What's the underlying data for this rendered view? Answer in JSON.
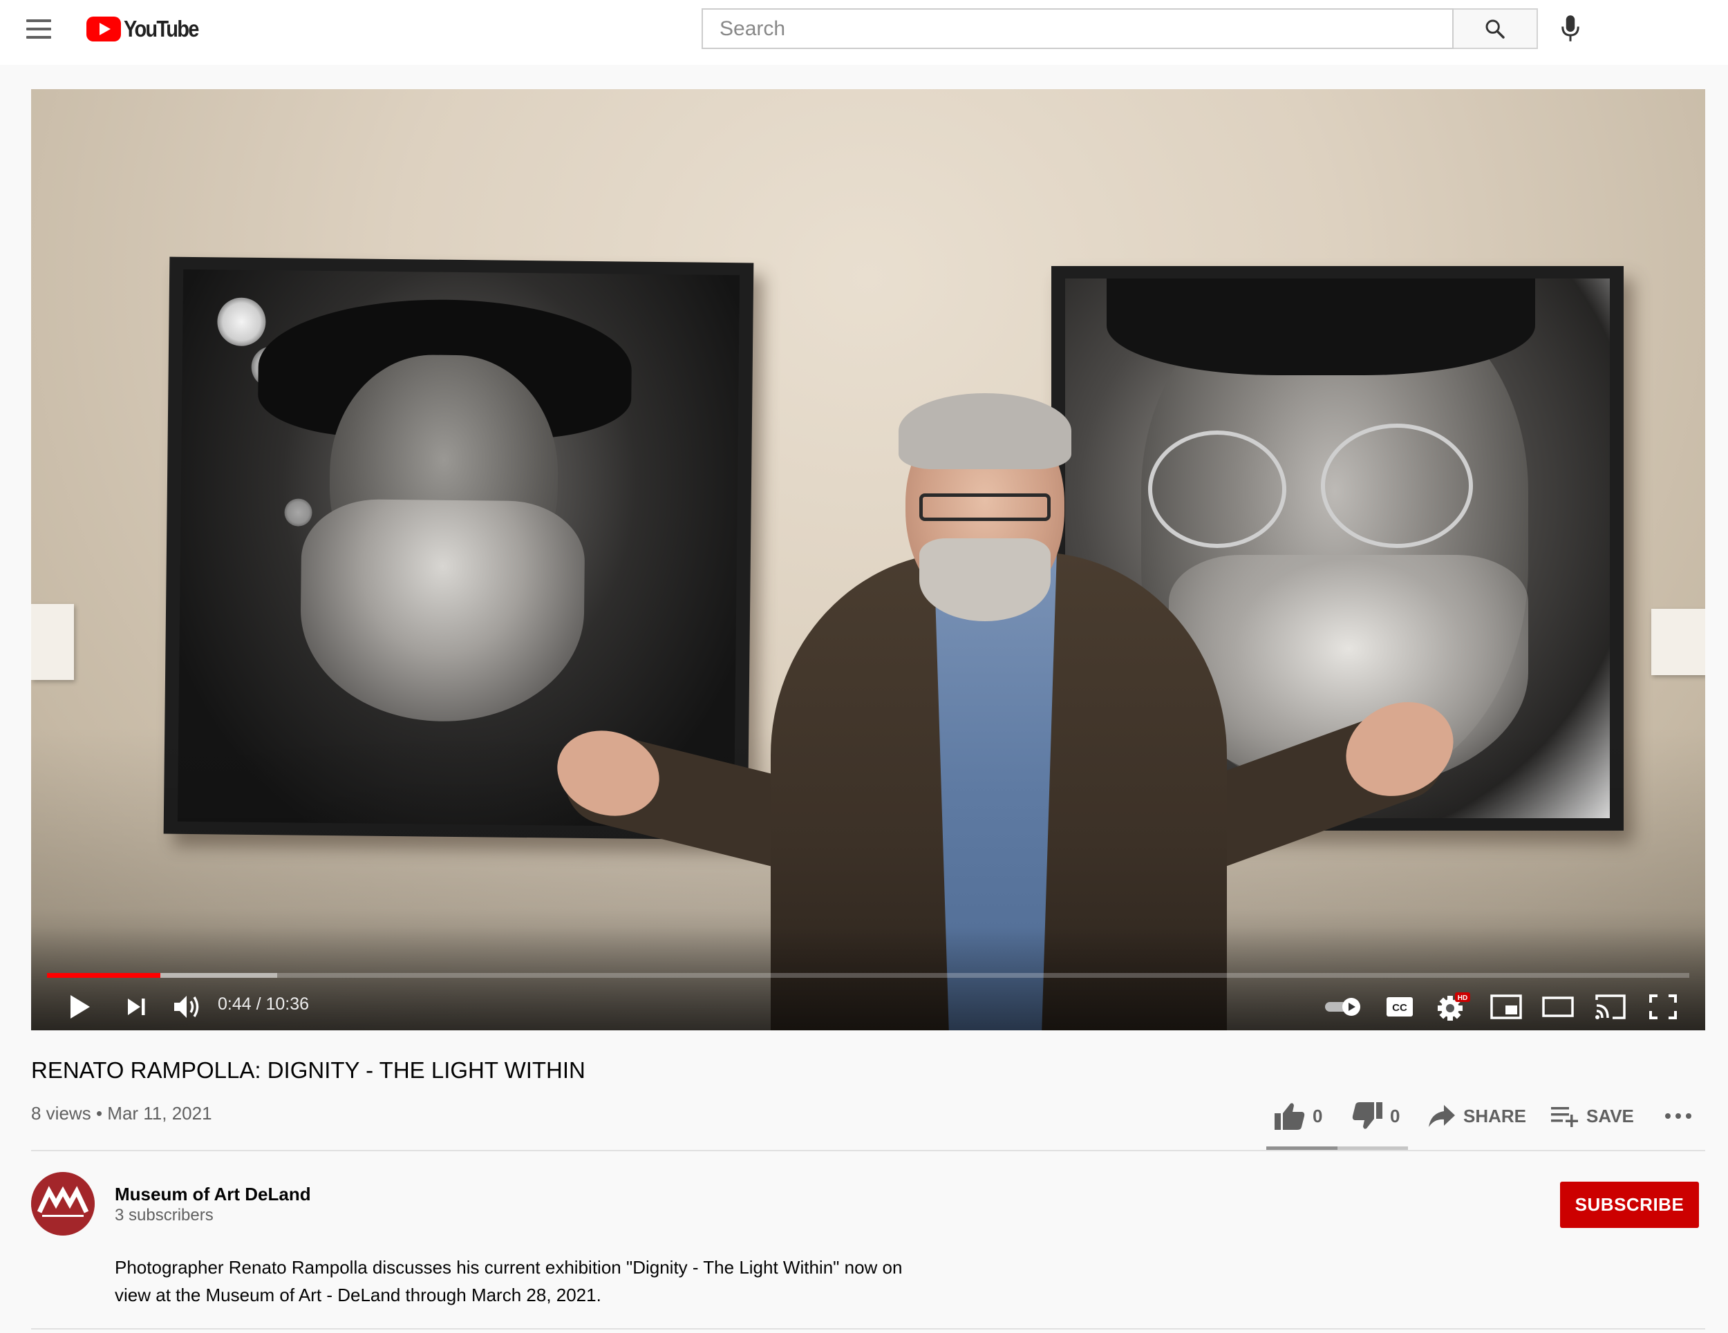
{
  "header": {
    "logo_text": "YouTube",
    "search_placeholder": "Search",
    "icons": [
      "menu-icon",
      "search-icon",
      "mic-icon"
    ]
  },
  "player": {
    "time_display": "0:44 / 10:36",
    "progress_fraction": 0.069,
    "buffered_fraction": 0.14,
    "controls": [
      "play-icon",
      "next-icon",
      "volume-icon",
      "autoplay-toggle",
      "captions-icon",
      "settings-icon",
      "miniplayer-icon",
      "theater-icon",
      "cast-icon",
      "fullscreen-icon"
    ],
    "settings_badge": "HD",
    "accent_color": "#ff0000"
  },
  "video": {
    "title": "RENATO RAMPOLLA: DIGNITY - THE LIGHT WITHIN",
    "views": "8 views",
    "separator": "•",
    "date": "Mar 11, 2021"
  },
  "actions": {
    "likes": "0",
    "dislikes": "0",
    "share_label": "SHARE",
    "save_label": "SAVE"
  },
  "channel": {
    "name": "Museum of Art DeLand",
    "subscribers": "3 subscribers",
    "avatar_color": "#a3262a",
    "subscribe_label": "SUBSCRIBE",
    "subscribe_color": "#cc0000"
  },
  "description": {
    "line1": "Photographer Renato Rampolla discusses his current exhibition \"Dignity - The Light Within\" now on",
    "line2": "view at the Museum of Art - DeLand through March 28, 2021."
  }
}
